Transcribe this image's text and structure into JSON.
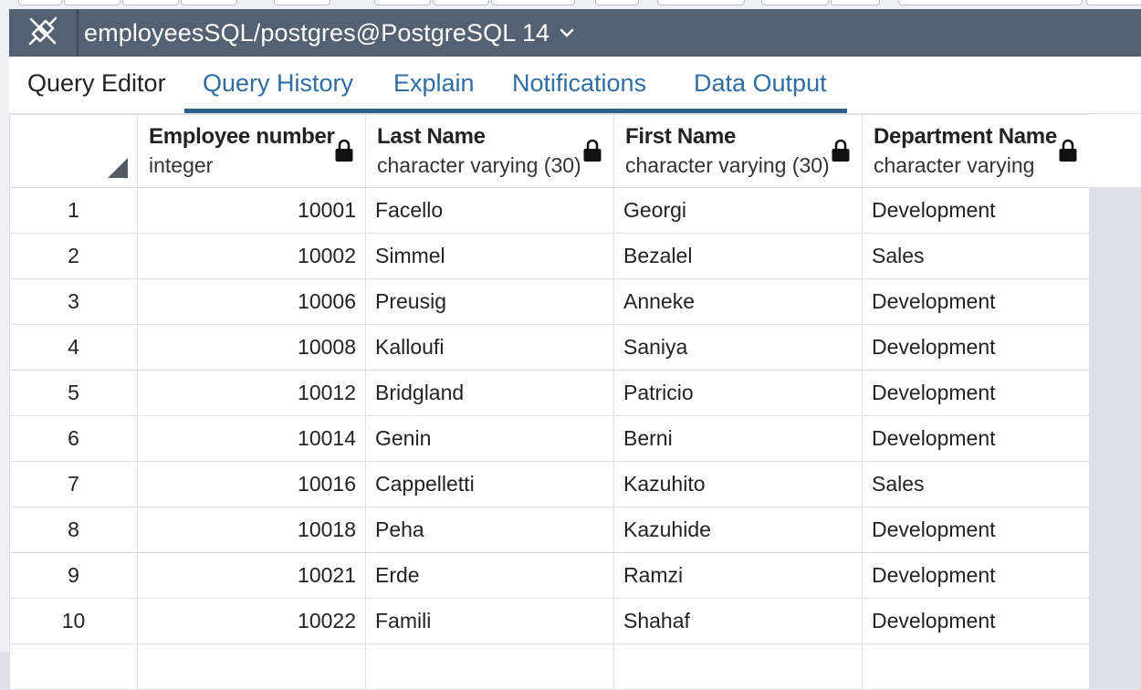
{
  "connection": {
    "label": "employeesSQL/postgres@PostgreSQL 14"
  },
  "tabs": [
    {
      "label": "Query Editor",
      "active": false
    },
    {
      "label": "Query History",
      "active": true
    },
    {
      "label": "Explain",
      "active": true
    },
    {
      "label": "Notifications",
      "active": true
    },
    {
      "label": "Data Output",
      "active": true
    }
  ],
  "grid": {
    "columns": [
      {
        "name": "Employee number",
        "type": "integer"
      },
      {
        "name": "Last Name",
        "type": "character varying (30)"
      },
      {
        "name": "First Name",
        "type": "character varying (30)"
      },
      {
        "name": "Department Name",
        "type": "character varying"
      }
    ],
    "rows": [
      {
        "n": "1",
        "emp_no": "10001",
        "last": "Facello",
        "first": "Georgi",
        "dept": "Development"
      },
      {
        "n": "2",
        "emp_no": "10002",
        "last": "Simmel",
        "first": "Bezalel",
        "dept": "Sales"
      },
      {
        "n": "3",
        "emp_no": "10006",
        "last": "Preusig",
        "first": "Anneke",
        "dept": "Development"
      },
      {
        "n": "4",
        "emp_no": "10008",
        "last": "Kalloufi",
        "first": "Saniya",
        "dept": "Development"
      },
      {
        "n": "5",
        "emp_no": "10012",
        "last": "Bridgland",
        "first": "Patricio",
        "dept": "Development"
      },
      {
        "n": "6",
        "emp_no": "10014",
        "last": "Genin",
        "first": "Berni",
        "dept": "Development"
      },
      {
        "n": "7",
        "emp_no": "10016",
        "last": "Cappelletti",
        "first": "Kazuhito",
        "dept": "Sales"
      },
      {
        "n": "8",
        "emp_no": "10018",
        "last": "Peha",
        "first": "Kazuhide",
        "dept": "Development"
      },
      {
        "n": "9",
        "emp_no": "10021",
        "last": "Erde",
        "first": "Ramzi",
        "dept": "Development"
      },
      {
        "n": "10",
        "emp_no": "10022",
        "last": "Famili",
        "first": "Shahaf",
        "dept": "Development"
      }
    ]
  },
  "colors": {
    "conn_bar": "#546170",
    "tab_text": "#2e6da4",
    "tab_underline": "#2f5f8c",
    "grid_border": "#dcdfe3"
  },
  "icons": {
    "connection": "disconnected-plug-icon",
    "caret": "chevron-down-icon",
    "lock": "lock-icon",
    "corner": "select-all-corner-icon"
  }
}
